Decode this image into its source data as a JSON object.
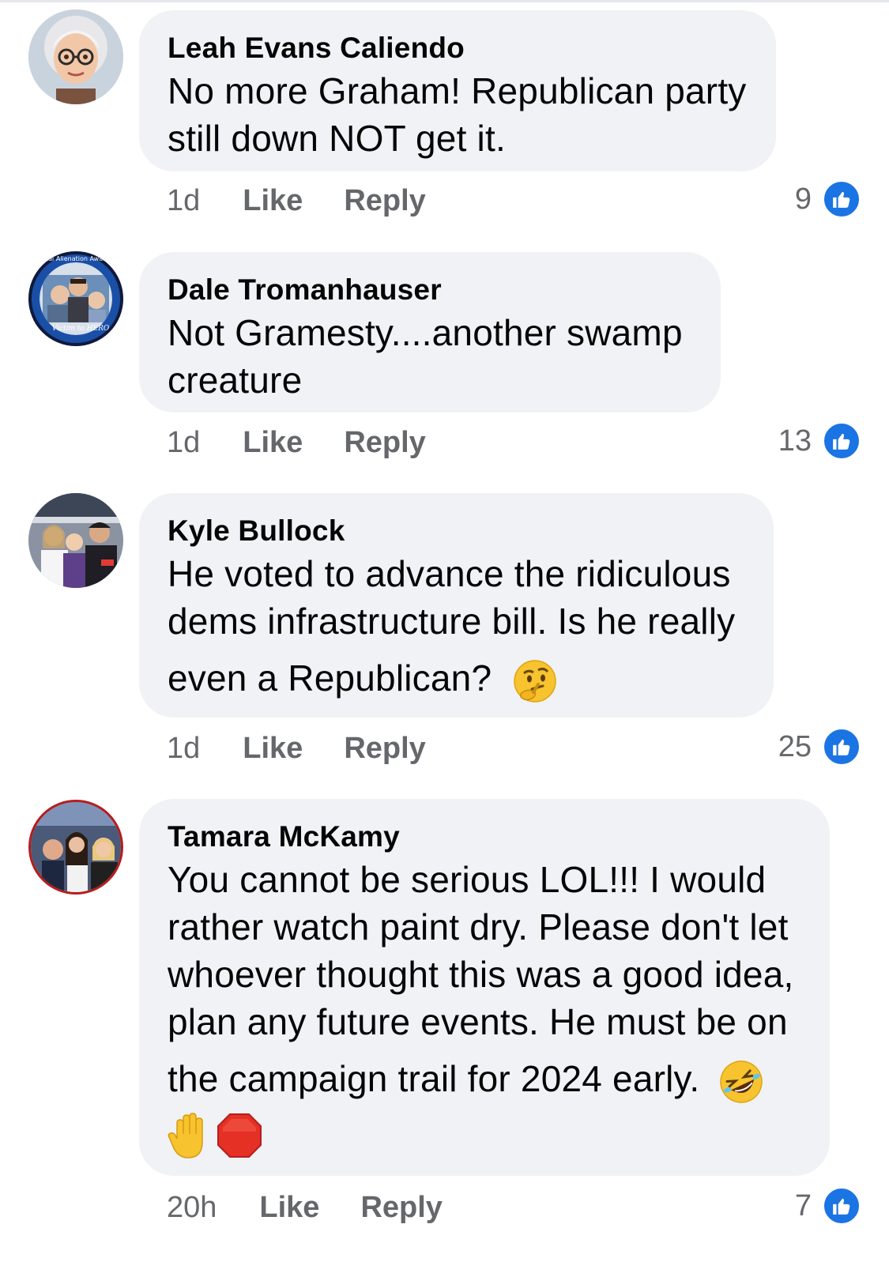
{
  "comments": [
    {
      "author": "Leah Evans Caliendo",
      "lines": [
        "No more Graham! Republican party",
        "still down NOT get it."
      ],
      "time": "1d",
      "like_label": "Like",
      "reply_label": "Reply",
      "reaction_count": "9",
      "reaction_icon": "thumbs-up-icon",
      "avatar": "cartoon-woman-avatar"
    },
    {
      "author": "Dale Tromanhauser",
      "lines": [
        "Not Gramesty....another swamp",
        "creature"
      ],
      "time": "1d",
      "like_label": "Like",
      "reply_label": "Reply",
      "reaction_count": "13",
      "reaction_icon": "thumbs-up-icon",
      "avatar": "parental-alienation-awareness-avatar",
      "avatar_badge_top": "Parental Alienation Awareness",
      "avatar_badge_bottom": "Victim to HERO"
    },
    {
      "author": "Kyle Bullock",
      "lines": [
        "He voted to advance the ridiculous",
        "dems infrastructure bill. Is he really",
        "even a Republican?"
      ],
      "emoji": [
        "thinking-face-emoji"
      ],
      "time": "1d",
      "like_label": "Like",
      "reply_label": "Reply",
      "reaction_count": "25",
      "reaction_icon": "thumbs-up-icon",
      "avatar": "family-hockey-photo-avatar"
    },
    {
      "author": "Tamara McKamy",
      "lines": [
        "You cannot be serious LOL!!! I would",
        "rather watch paint dry. Please don't let",
        "whoever thought this was a good idea,",
        "plan any future events. He must be on",
        "the campaign trail for 2024 early."
      ],
      "emoji": [
        "rolling-on-floor-laughing-emoji",
        "raised-hand-emoji",
        "stop-sign-emoji"
      ],
      "time": "20h",
      "like_label": "Like",
      "reply_label": "Reply",
      "reaction_count": "7",
      "reaction_icon": "thumbs-up-icon",
      "avatar": "group-selfie-avatar"
    }
  ],
  "colors": {
    "bubble": "#f0f2f5",
    "meta_text": "#65676b",
    "like_blue": "#1b74e4",
    "body_text": "#050505"
  }
}
